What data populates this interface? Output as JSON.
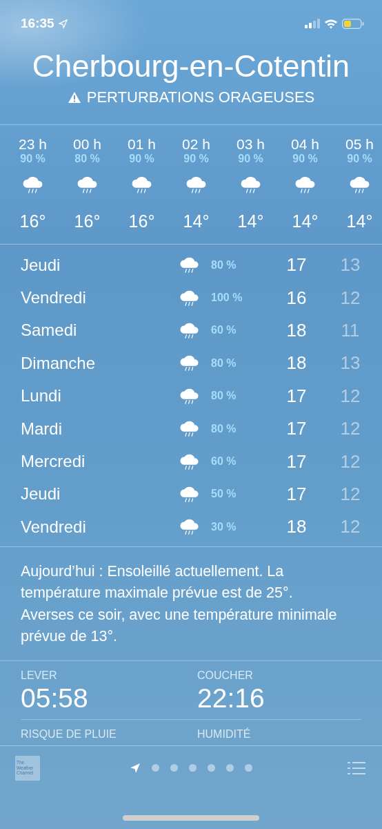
{
  "status_bar": {
    "time": "16:35"
  },
  "location": {
    "city": "Cherbourg-en-Cotentin",
    "alert": "PERTURBATIONS ORAGEUSES"
  },
  "hourly": [
    {
      "hour": "23 h",
      "chance": "90 %",
      "temp": "16°"
    },
    {
      "hour": "00 h",
      "chance": "80 %",
      "temp": "16°"
    },
    {
      "hour": "01 h",
      "chance": "90 %",
      "temp": "16°"
    },
    {
      "hour": "02 h",
      "chance": "90 %",
      "temp": "14°"
    },
    {
      "hour": "03 h",
      "chance": "90 %",
      "temp": "14°"
    },
    {
      "hour": "04 h",
      "chance": "90 %",
      "temp": "14°"
    },
    {
      "hour": "05 h",
      "chance": "90 %",
      "temp": "14°"
    }
  ],
  "daily": [
    {
      "day": "Jeudi",
      "chance": "80 %",
      "high": "17",
      "low": "13"
    },
    {
      "day": "Vendredi",
      "chance": "100 %",
      "high": "16",
      "low": "12"
    },
    {
      "day": "Samedi",
      "chance": "60 %",
      "high": "18",
      "low": "11"
    },
    {
      "day": "Dimanche",
      "chance": "80 %",
      "high": "18",
      "low": "13"
    },
    {
      "day": "Lundi",
      "chance": "80 %",
      "high": "17",
      "low": "12"
    },
    {
      "day": "Mardi",
      "chance": "80 %",
      "high": "17",
      "low": "12"
    },
    {
      "day": "Mercredi",
      "chance": "60 %",
      "high": "17",
      "low": "12"
    },
    {
      "day": "Jeudi",
      "chance": "50 %",
      "high": "17",
      "low": "12"
    },
    {
      "day": "Vendredi",
      "chance": "30 %",
      "high": "18",
      "low": "12"
    }
  ],
  "summary": "Aujourd’hui : Ensoleillé actuellement. La température maximale prévue est de 25°. Averses ce soir, avec une température minimale prévue de 13°.",
  "details": [
    {
      "label": "LEVER",
      "value": "05:58"
    },
    {
      "label": "COUCHER",
      "value": "22:16"
    },
    {
      "label": "RISQUE DE PLUIE"
    },
    {
      "label": "HUMIDITÉ"
    }
  ],
  "footer": {
    "logo": [
      "The",
      "Weather",
      "Channel"
    ],
    "pages": [
      {
        "kind": "location",
        "selected": true
      },
      {
        "kind": "dot",
        "selected": false
      },
      {
        "kind": "dot",
        "selected": false
      },
      {
        "kind": "dot",
        "selected": false
      },
      {
        "kind": "dot",
        "selected": false
      },
      {
        "kind": "dot",
        "selected": false
      },
      {
        "kind": "dot",
        "selected": false
      }
    ]
  }
}
